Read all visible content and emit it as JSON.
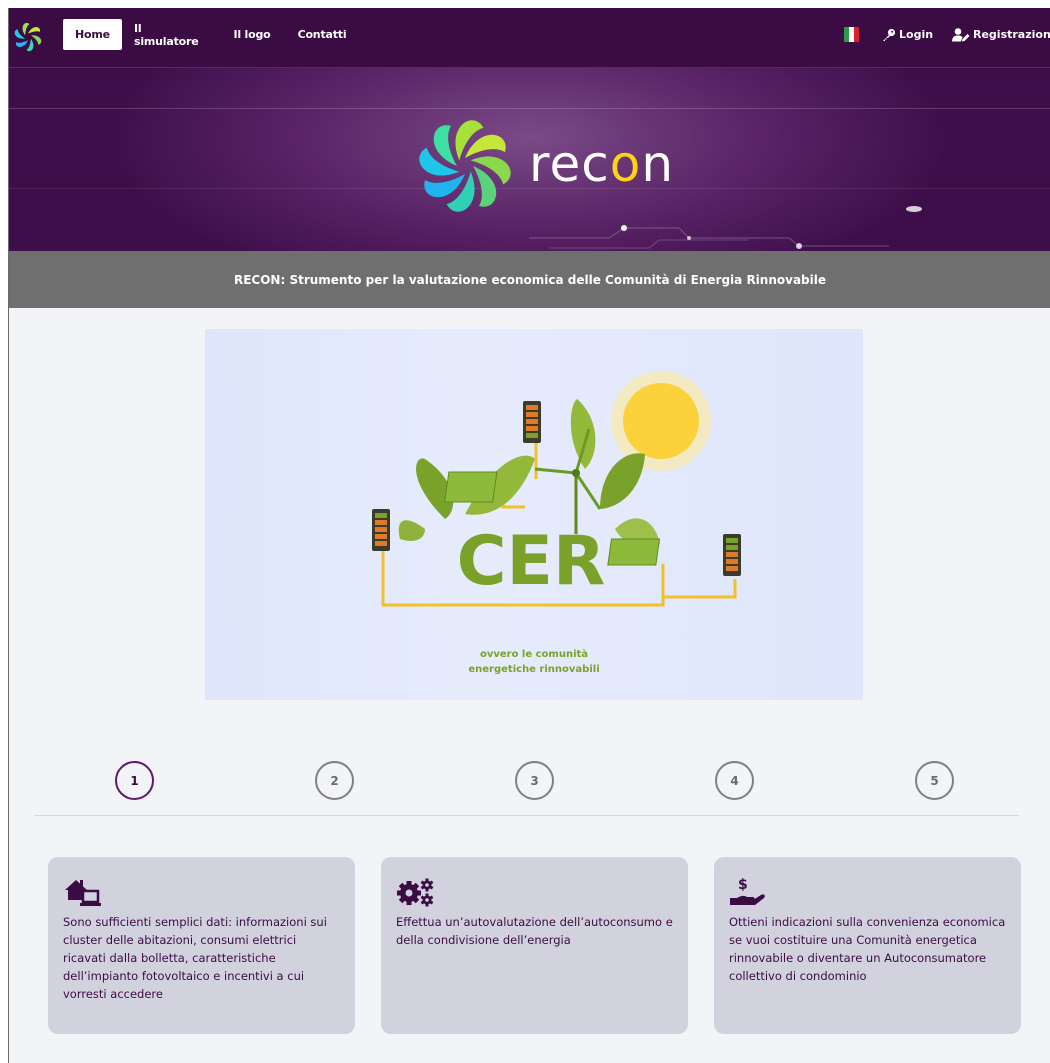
{
  "nav": {
    "items": [
      "Home",
      "Il simulatore",
      "Il logo",
      "Contatti"
    ],
    "login": "Login",
    "register": "Registrazione"
  },
  "hero": {
    "brand": "recon"
  },
  "subtitle": "RECON: Strumento per la valutazione economica delle Comunità di Energia Rinnovabile",
  "illustration": {
    "cer_text": "CER",
    "caption_line1": "ovvero le comunità",
    "caption_line2": "energetiche rinnovabili"
  },
  "steps": [
    "1",
    "2",
    "3",
    "4",
    "5"
  ],
  "cards": [
    {
      "icon": "home-laptop-icon",
      "text": "Sono sufficienti semplici dati: informazioni sui cluster delle abitazioni, consumi elettrici ricavati dalla bolletta, caratteristiche dell’impianto fotovoltaico e incentivi a cui vorresti accedere"
    },
    {
      "icon": "cogs-icon",
      "text": "Effettua un’autovalutazione dell’autoconsumo e della condivisione dell’energia"
    },
    {
      "icon": "hand-dollar-icon",
      "text": "Ottieni indicazioni sulla convenienza economica se vuoi costituire una Comunità energetica rinnovabile o diventare un Autoconsumatore collettivo di condominio"
    }
  ],
  "colors": {
    "brand": "#3b0c44",
    "accent_yellow": "#ffd21a",
    "leaf_green": "#7aa22a",
    "card_bg": "#d2d2df"
  }
}
